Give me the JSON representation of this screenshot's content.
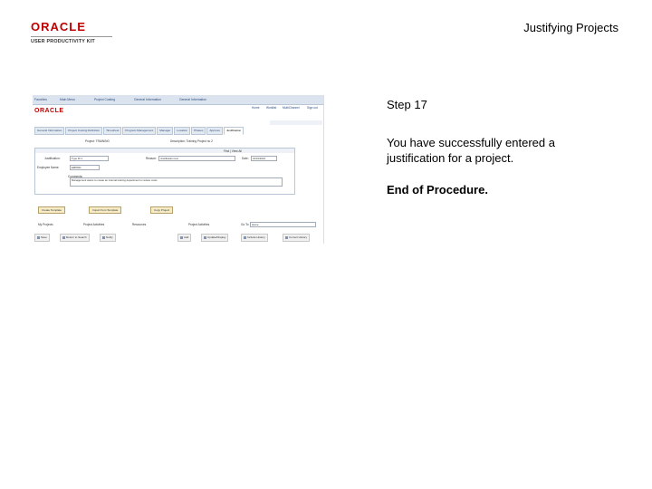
{
  "header": {
    "logo_brand": "ORACLE",
    "logo_product": "USER PRODUCTIVITY KIT",
    "doc_title": "Justifying Projects"
  },
  "content": {
    "step_label": "Step 17",
    "description": "You have successfully entered a justification for a project.",
    "end_label": "End of Procedure."
  },
  "screenshot": {
    "nav_items": [
      "Favorites",
      "Main Menu",
      "Project Costing",
      "General Information",
      "General Information"
    ],
    "brand": "ORACLE",
    "top_links": [
      "Home",
      "Worklist",
      "MultiChannel",
      "Sign out"
    ],
    "tabs": [
      "General Information",
      "Project Costing Definition",
      "Timesheet",
      "Program Management",
      "Manager",
      "Location",
      "Phases",
      "Approve",
      "Justification"
    ],
    "business_unit_label": "Project: TRAINING",
    "description_label": "Description: Training Project no 2",
    "find_link": "Find | View All",
    "justification_label": "Justification:",
    "justification_value": "Type ID 1",
    "reason_label": "Reason:",
    "reason_value": "Justification text",
    "date_label": "Date:",
    "date_value": "01/01/2024",
    "employee_label": "Employee Name:",
    "employee_value": "EMP001",
    "comments_label": "Comments:",
    "comments_value": "Management wants to create an internal training department to reduce costs",
    "buttons": [
      "Create Template",
      "Import from Template",
      "Copy Project"
    ],
    "list_labels": [
      "My Projects",
      "Project Activities",
      "Resources",
      "Project Activities",
      "Go To:"
    ],
    "goto_value": "Home",
    "footer_left": [
      "Save",
      "Return to Search",
      "Notify"
    ],
    "footer_right": [
      "Add",
      "Update/Display",
      "Include History",
      "Correct History"
    ]
  },
  "colors": {
    "brand_red": "#c00000",
    "nav_bg": "#dbe4ee",
    "button_bg": "#f7ecc6"
  }
}
